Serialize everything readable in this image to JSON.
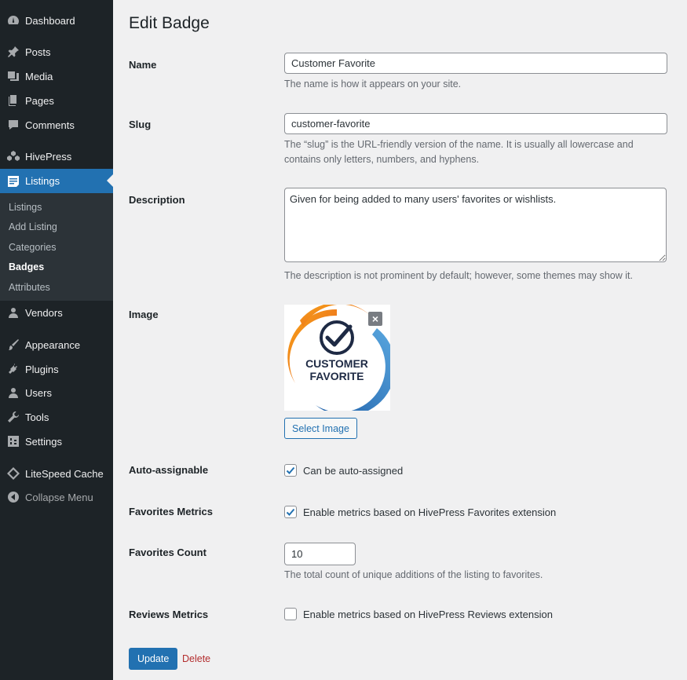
{
  "sidebar": {
    "items": [
      {
        "label": "Dashboard",
        "icon": "dashboard-icon"
      },
      {
        "label": "Posts",
        "icon": "pin-icon"
      },
      {
        "label": "Media",
        "icon": "media-icon"
      },
      {
        "label": "Pages",
        "icon": "pages-icon"
      },
      {
        "label": "Comments",
        "icon": "comment-icon"
      },
      {
        "label": "HivePress",
        "icon": "hivepress-icon"
      },
      {
        "label": "Listings",
        "icon": "listings-icon"
      },
      {
        "label": "Vendors",
        "icon": "user-icon"
      },
      {
        "label": "Appearance",
        "icon": "brush-icon"
      },
      {
        "label": "Plugins",
        "icon": "plugin-icon"
      },
      {
        "label": "Users",
        "icon": "users-icon"
      },
      {
        "label": "Tools",
        "icon": "wrench-icon"
      },
      {
        "label": "Settings",
        "icon": "settings-icon"
      },
      {
        "label": "LiteSpeed Cache",
        "icon": "diamond-icon"
      },
      {
        "label": "Collapse Menu",
        "icon": "collapse-icon"
      }
    ],
    "submenu": [
      "Listings",
      "Add Listing",
      "Categories",
      "Badges",
      "Attributes"
    ],
    "active_color": "#2271b1"
  },
  "page": {
    "title": "Edit Badge",
    "name": {
      "label": "Name",
      "value": "Customer Favorite",
      "help": "The name is how it appears on your site."
    },
    "slug": {
      "label": "Slug",
      "value": "customer-favorite",
      "help": "The “slug” is the URL-friendly version of the name. It is usually all lowercase and contains only letters, numbers, and hyphens."
    },
    "description": {
      "label": "Description",
      "value": "Given for being added to many users' favorites or wishlists.",
      "help": "The description is not prominent by default; however, some themes may show it."
    },
    "image": {
      "label": "Image",
      "badge_line1": "CUSTOMER",
      "badge_line2": "FAVORITE",
      "select_label": "Select Image",
      "remove_symbol": "×"
    },
    "auto_assignable": {
      "label": "Auto-assignable",
      "checkbox_label": "Can be auto-assigned",
      "checked": true
    },
    "favorites_metrics": {
      "label": "Favorites Metrics",
      "checkbox_label": "Enable metrics based on HivePress Favorites extension",
      "checked": true
    },
    "favorites_count": {
      "label": "Favorites Count",
      "value": "10",
      "help": "The total count of unique additions of the listing to favorites."
    },
    "reviews_metrics": {
      "label": "Reviews Metrics",
      "checkbox_label": "Enable metrics based on HivePress Reviews extension",
      "checked": false
    },
    "update_label": "Update",
    "delete_label": "Delete"
  }
}
